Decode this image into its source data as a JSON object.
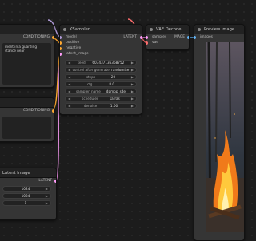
{
  "clip_node": {
    "output_label": "CONDITIONING",
    "prompt_text": "ment in a guarding stance near"
  },
  "clip_node_2": {
    "output_label": "CONDITIONING"
  },
  "ksampler": {
    "title": "KSampler",
    "inputs": [
      "model",
      "positive",
      "negative",
      "latent_image"
    ],
    "output_label": "LATENT",
    "widgets": [
      {
        "label": "seed",
        "value": "603437136368752"
      },
      {
        "label": "control after generate",
        "value": "randomize"
      },
      {
        "label": "steps",
        "value": "20"
      },
      {
        "label": "cfg",
        "value": "8.0"
      },
      {
        "label": "sampler_name",
        "value": "dpmpp_sde"
      },
      {
        "label": "scheduler",
        "value": "karras"
      },
      {
        "label": "denoise",
        "value": "1.00"
      }
    ]
  },
  "vae_decode": {
    "title": "VAE Decode",
    "inputs": [
      "samples",
      "vae"
    ],
    "output_label": "IMAGE"
  },
  "preview": {
    "title": "Preview Image",
    "input_label": "images"
  },
  "latent": {
    "title": "Latent Image",
    "output_label": "LATENT",
    "widgets": [
      {
        "label": "",
        "value": "1024"
      },
      {
        "label": "",
        "value": "1024"
      },
      {
        "label": "",
        "value": "1"
      }
    ]
  },
  "colors": {
    "model": "#b39ddb",
    "conditioning": "#ffa931",
    "latent": "#ff9cf9",
    "vae": "#ff6e6e",
    "image": "#64b5f6"
  }
}
